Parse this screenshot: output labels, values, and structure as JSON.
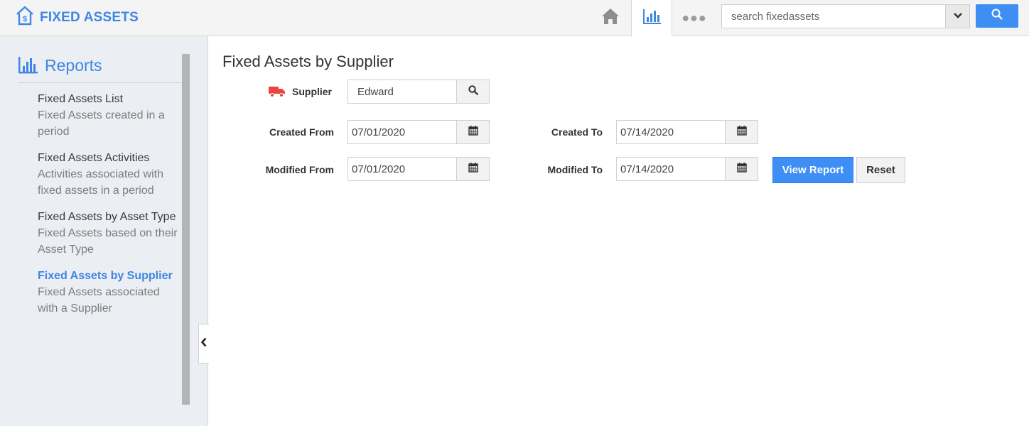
{
  "app": {
    "title": "FIXED ASSETS"
  },
  "header": {
    "nav": {
      "home_icon": "home-icon",
      "reports_icon": "bar-chart-icon",
      "more_icon": "ellipsis-icon",
      "more_label": "●●●"
    },
    "search": {
      "placeholder": "search fixedassets",
      "value": ""
    }
  },
  "sidebar": {
    "title": "Reports",
    "items": [
      {
        "title": "Fixed Assets List",
        "desc": "Fixed Assets created in a period",
        "active": false
      },
      {
        "title": "Fixed Assets Activities",
        "desc": "Activities associated with fixed assets in a period",
        "active": false
      },
      {
        "title": "Fixed Assets by Asset Type",
        "desc": "Fixed Assets based on their Asset Type",
        "active": false
      },
      {
        "title": "Fixed Assets by Supplier",
        "desc": "Fixed Assets associated with a Supplier",
        "active": true
      }
    ]
  },
  "main": {
    "title": "Fixed Assets by Supplier",
    "supplier": {
      "label": "Supplier",
      "value": "Edward"
    },
    "created_from": {
      "label": "Created From",
      "value": "07/01/2020"
    },
    "created_to": {
      "label": "Created To",
      "value": "07/14/2020"
    },
    "modified_from": {
      "label": "Modified From",
      "value": "07/01/2020"
    },
    "modified_to": {
      "label": "Modified To",
      "value": "07/14/2020"
    },
    "view_report_label": "View Report",
    "reset_label": "Reset"
  },
  "colors": {
    "accent": "#3d86e3",
    "button_primary": "#3d8ef5",
    "truck": "#e8463c"
  }
}
